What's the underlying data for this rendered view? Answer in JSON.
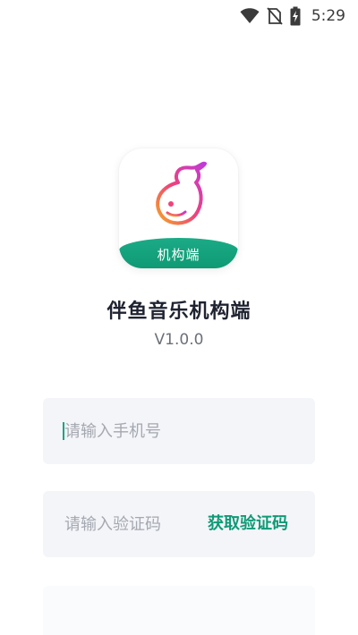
{
  "status_bar": {
    "time": "5:29",
    "icons": [
      "wifi-icon",
      "no-sim-icon",
      "battery-charging-icon"
    ]
  },
  "app": {
    "icon_label": "机构端",
    "title": "伴鱼音乐机构端",
    "version": "V1.0.0"
  },
  "login": {
    "phone_placeholder": "请输入手机号",
    "code_placeholder": "请输入验证码",
    "get_code_label": "获取验证码"
  },
  "colors": {
    "accent": "#0f9a76",
    "field_bg": "#f4f5f9",
    "title": "#1f2330"
  }
}
